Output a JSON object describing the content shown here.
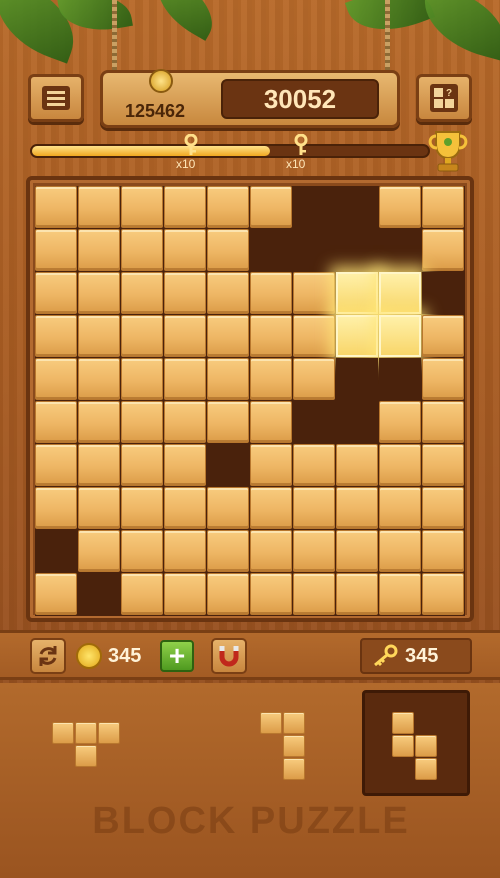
{
  "header": {
    "best_score": "125462",
    "current_score": "30052",
    "menu_icon": "menu-icon",
    "piece_toggle_icon": "blocks-help-icon",
    "medal_icon": "crown-medal-icon"
  },
  "progress": {
    "fill_percent": 60,
    "milestones": [
      {
        "label": "x10",
        "icon": "key-icon"
      },
      {
        "label": "x10",
        "icon": "key-icon"
      }
    ],
    "goal_icon": "trophy-icon"
  },
  "board": {
    "size": 10,
    "empty_cells": [
      [
        0,
        6
      ],
      [
        0,
        7
      ],
      [
        1,
        5
      ],
      [
        1,
        6
      ],
      [
        1,
        7
      ],
      [
        1,
        8
      ],
      [
        2,
        7
      ],
      [
        2,
        9
      ],
      [
        3,
        8
      ],
      [
        4,
        7
      ],
      [
        4,
        8
      ],
      [
        5,
        6
      ],
      [
        5,
        7
      ],
      [
        6,
        4
      ],
      [
        8,
        0
      ],
      [
        9,
        1
      ]
    ],
    "glow_cells": [
      [
        2,
        7
      ],
      [
        2,
        8
      ],
      [
        3,
        7
      ],
      [
        3,
        8
      ]
    ]
  },
  "toolbar": {
    "refresh_icon": "refresh-icon",
    "coin_icon": "coin-icon",
    "coins": "345",
    "add_label": "+",
    "magnet_icon": "magnet-icon",
    "key_icon": "key-icon",
    "keys": "345"
  },
  "tray": {
    "pieces": [
      {
        "name": "t-piece",
        "cells": [
          [
            0,
            0
          ],
          [
            0,
            1
          ],
          [
            0,
            2
          ],
          [
            1,
            1
          ]
        ]
      },
      {
        "name": "j-piece",
        "cells": [
          [
            0,
            0
          ],
          [
            0,
            1
          ],
          [
            1,
            1
          ],
          [
            2,
            1
          ]
        ]
      },
      {
        "name": "s-piece",
        "cells": [
          [
            0,
            0
          ],
          [
            1,
            0
          ],
          [
            1,
            1
          ],
          [
            2,
            1
          ]
        ]
      }
    ],
    "selected_index": 2
  },
  "logo_text": "BLOCK PUZZLE"
}
